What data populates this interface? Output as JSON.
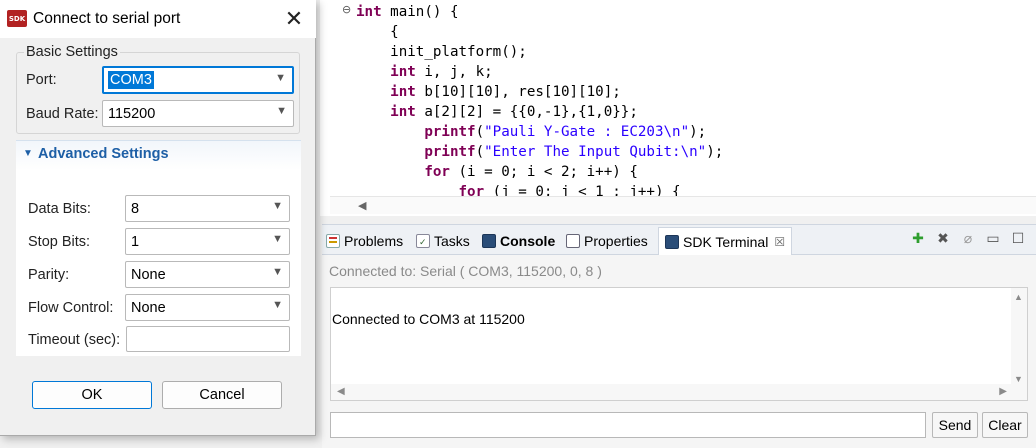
{
  "editor": {
    "fold_marker": "⊖",
    "lines": [
      {
        "parts": [
          {
            "t": "int",
            "c": "kw"
          },
          {
            "t": " main() {",
            "c": ""
          }
        ]
      },
      {
        "parts": [
          {
            "t": "    {",
            "c": ""
          }
        ]
      },
      {
        "parts": [
          {
            "t": "    init_platform();",
            "c": ""
          }
        ]
      },
      {
        "parts": [
          {
            "t": "    ",
            "c": ""
          },
          {
            "t": "int",
            "c": "kw"
          },
          {
            "t": " i, j, k;",
            "c": ""
          }
        ]
      },
      {
        "parts": [
          {
            "t": "    ",
            "c": ""
          },
          {
            "t": "int",
            "c": "kw"
          },
          {
            "t": " b[10][10], res[10][10];",
            "c": ""
          }
        ]
      },
      {
        "parts": [
          {
            "t": "    ",
            "c": ""
          },
          {
            "t": "int",
            "c": "kw"
          },
          {
            "t": " a[2][2] = {{0,-1},{1,0}};",
            "c": ""
          }
        ]
      },
      {
        "parts": [
          {
            "t": "        ",
            "c": ""
          },
          {
            "t": "printf",
            "c": "kw"
          },
          {
            "t": "(",
            "c": ""
          },
          {
            "t": "\"Pauli Y-Gate : EC203\\n\"",
            "c": "str"
          },
          {
            "t": ");",
            "c": ""
          }
        ]
      },
      {
        "parts": [
          {
            "t": "        ",
            "c": ""
          },
          {
            "t": "printf",
            "c": "kw"
          },
          {
            "t": "(",
            "c": ""
          },
          {
            "t": "\"Enter The Input Qubit:\\n\"",
            "c": "str"
          },
          {
            "t": ");",
            "c": ""
          }
        ]
      },
      {
        "parts": [
          {
            "t": "        ",
            "c": ""
          },
          {
            "t": "for",
            "c": "kw"
          },
          {
            "t": " (i = 0; i < 2; i++) {",
            "c": ""
          }
        ]
      },
      {
        "parts": [
          {
            "t": "            ",
            "c": ""
          },
          {
            "t": "for",
            "c": "kw"
          },
          {
            "t": " (j = 0; j < 1 ; j++) {",
            "c": ""
          }
        ]
      }
    ]
  },
  "views": {
    "tabs": [
      {
        "label": "Problems",
        "icon": "problems-icon"
      },
      {
        "label": "Tasks",
        "icon": "tasks-icon"
      },
      {
        "label": "Console",
        "icon": "console-icon"
      },
      {
        "label": "Properties",
        "icon": "properties-icon"
      },
      {
        "label": "SDK Terminal",
        "icon": "terminal-icon"
      }
    ],
    "active_tab_close": "☒",
    "tools": {
      "connect": "✚",
      "disconnect": "✖",
      "clear": "⌀",
      "minimize": "▭",
      "maximize": "☐"
    }
  },
  "terminal": {
    "status": "Connected to: Serial (  COM3, 115200, 0, 8 )",
    "output": "Connected to COM3 at 115200",
    "send_label": "Send",
    "clear_label": "Clear",
    "input_value": ""
  },
  "dialog": {
    "title": "Connect to serial port",
    "app_icon_text": "SDK",
    "close_glyph": "✕",
    "basic_settings": {
      "legend": "Basic Settings",
      "port_label": "Port:",
      "port_value": "COM3",
      "baud_label": "Baud Rate:",
      "baud_value": "115200"
    },
    "advanced_settings": {
      "title": "Advanced Settings",
      "data_bits_label": "Data Bits:",
      "data_bits_value": "8",
      "stop_bits_label": "Stop Bits:",
      "stop_bits_value": "1",
      "parity_label": "Parity:",
      "parity_value": "None",
      "flow_control_label": "Flow Control:",
      "flow_control_value": "None",
      "timeout_label": "Timeout (sec):",
      "timeout_value": ""
    },
    "ok_label": "OK",
    "cancel_label": "Cancel"
  },
  "background_edge": {
    "char": "e",
    "arrow": "▶"
  },
  "colors": {
    "accent": "#0078d7",
    "keyword": "#7f0055",
    "string": "#2a00ff",
    "section_title": "#1d5fa6",
    "status_gray": "#8a8a8a"
  }
}
